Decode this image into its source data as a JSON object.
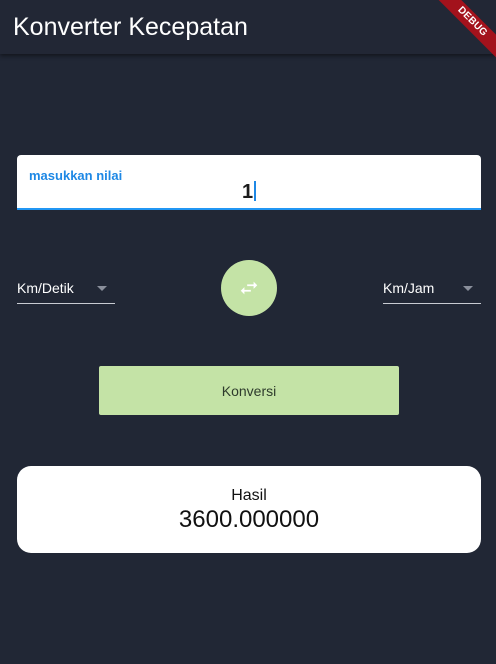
{
  "app": {
    "title": "Konverter Kecepatan",
    "debug_label": "DEBUG"
  },
  "input": {
    "label": "masukkan nilai",
    "value": "1"
  },
  "units": {
    "from": "Km/Detik",
    "to": "Km/Jam"
  },
  "actions": {
    "convert_label": "Konversi",
    "swap_icon": "swap-horizontal-icon"
  },
  "result": {
    "label": "Hasil",
    "value": "3600.000000"
  },
  "colors": {
    "background": "#212735",
    "accent_green": "#c4e3a6",
    "focus_blue": "#2196f3",
    "debug_red": "#a3121c"
  }
}
